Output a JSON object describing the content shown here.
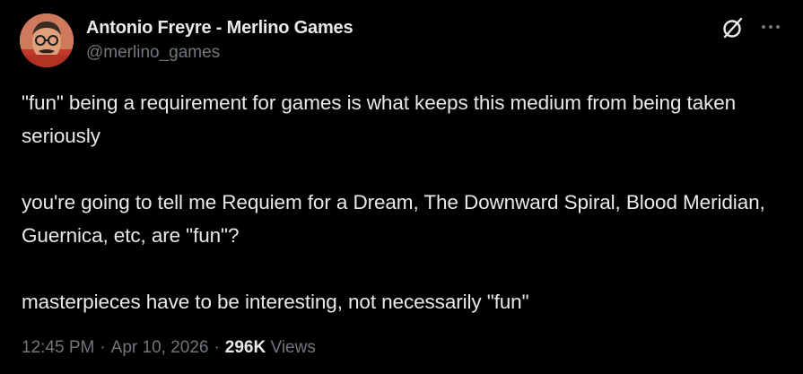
{
  "author": {
    "display_name": "Antonio Freyre - Merlino Games",
    "handle": "@merlino_games"
  },
  "tweet": {
    "paragraphs": [
      "\"fun\" being a requirement for games is what keeps this medium from being taken seriously",
      "you're going to tell me Requiem for a Dream, The Downward Spiral, Blood Meridian, Guernica, etc, are \"fun\"?",
      "masterpieces have to be interesting, not necessarily \"fun\""
    ]
  },
  "meta": {
    "time": "12:45 PM",
    "separator": "·",
    "date": "Apr 10, 2026",
    "views_count": "296K",
    "views_label": "Views"
  },
  "icons": {
    "grok": "grok-icon",
    "more": "more-icon"
  },
  "colors": {
    "background": "#000000",
    "primary_text": "#e7e9ea",
    "secondary_text": "#71767b"
  }
}
